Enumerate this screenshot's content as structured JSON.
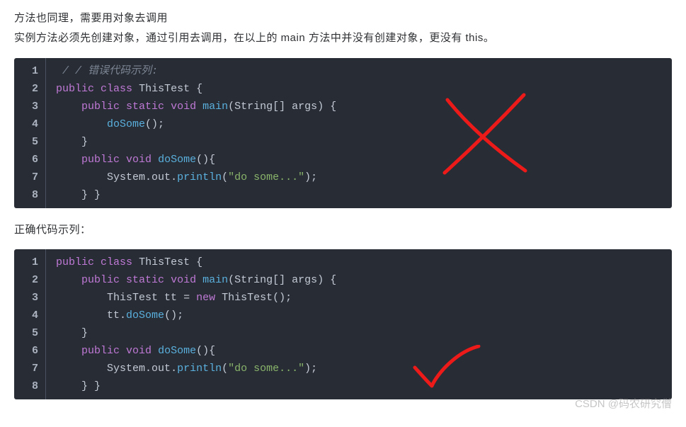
{
  "intro": {
    "line1": "方法也同理，需要用对象去调用",
    "line2": "实例方法必须先创建对象，通过引用去调用，在以上的 main 方法中并没有创建对象，更没有 this。"
  },
  "block1": {
    "comment": " / / 错误代码示列:",
    "kw_public": "public",
    "kw_class": "class",
    "cls_name": "ThisTest",
    "kw_static": "static",
    "kw_void": "void",
    "main": "main",
    "param_type": "String",
    "param_name": "args",
    "call_doSome": "doSome",
    "decl_doSome": "doSome",
    "sys": "System",
    "out": "out",
    "println": "println",
    "str": "\"do some...\"",
    "line_nums": [
      "1",
      "2",
      "3",
      "4",
      "5",
      "6",
      "7",
      "8"
    ]
  },
  "mid_label": "正确代码示列：",
  "block2": {
    "kw_public": "public",
    "kw_class": "class",
    "cls_name": "ThisTest",
    "kw_static": "static",
    "kw_void": "void",
    "main": "main",
    "param_type": "String",
    "param_name": "args",
    "tt": "tt",
    "kw_new": "new",
    "call_doSome": "doSome",
    "decl_doSome": "doSome",
    "sys": "System",
    "out": "out",
    "println": "println",
    "str": "\"do some...\"",
    "line_nums": [
      "1",
      "2",
      "3",
      "4",
      "5",
      "6",
      "7",
      "8"
    ]
  },
  "watermark": "CSDN @码农研究僧"
}
